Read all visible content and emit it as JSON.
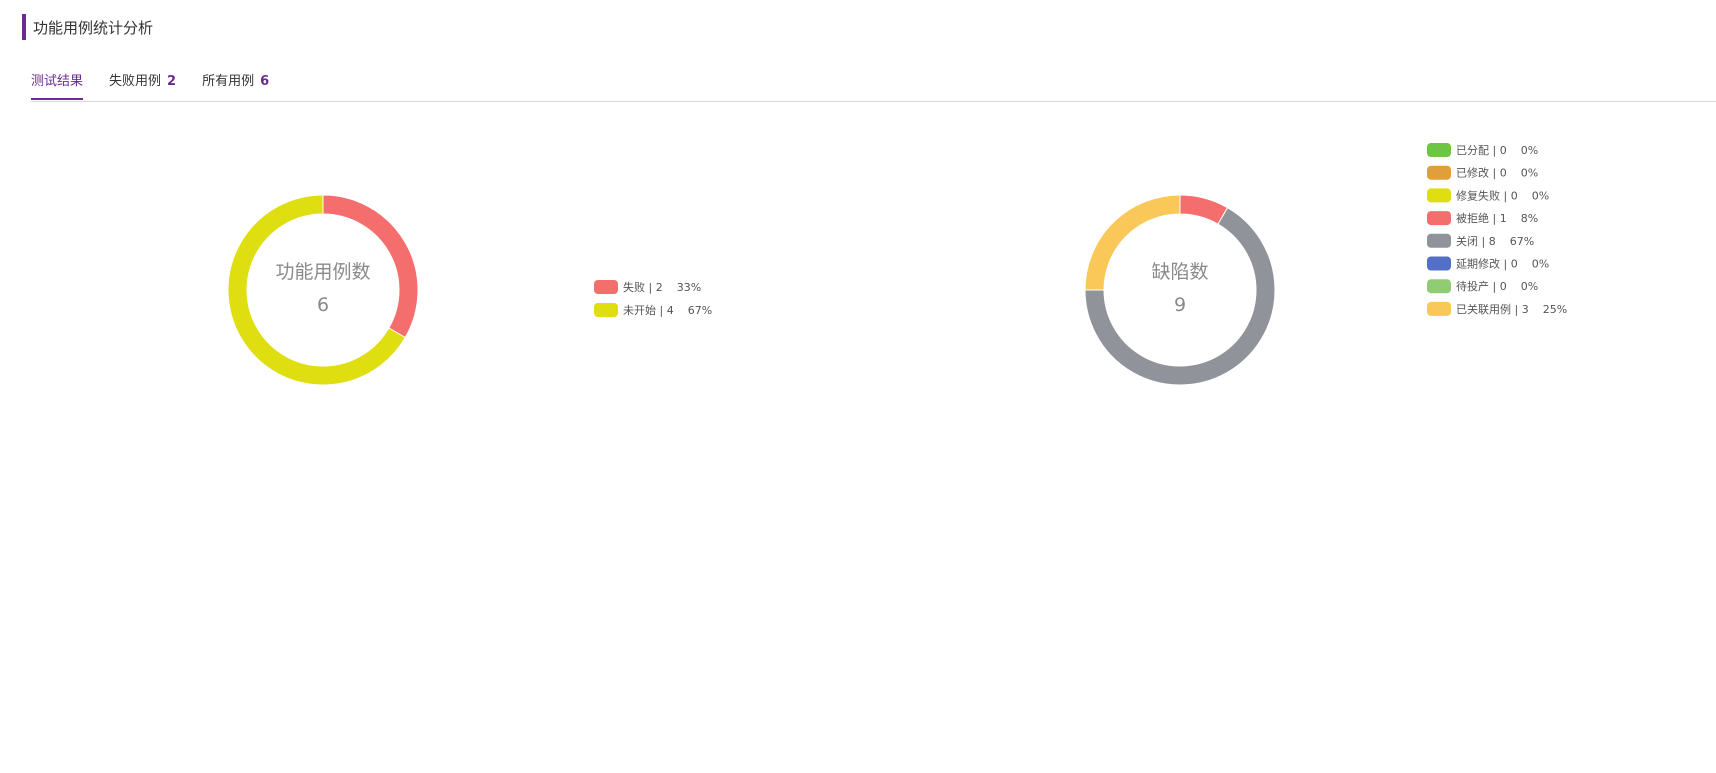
{
  "header": {
    "title": "功能用例统计分析"
  },
  "tabs": [
    {
      "label": "测试结果",
      "count": "",
      "active": true
    },
    {
      "label": "失败用例",
      "count": "2",
      "active": false
    },
    {
      "label": "所有用例",
      "count": "6",
      "active": false
    }
  ],
  "chart_data": [
    {
      "type": "pie",
      "center_title": "功能用例数",
      "center_value": "6",
      "slices": [
        {
          "name": "失败",
          "value": 2,
          "percent": "33%",
          "color": "#f46e6e"
        },
        {
          "name": "未开始",
          "value": 4,
          "percent": "67%",
          "color": "#dede10"
        }
      ]
    },
    {
      "type": "pie",
      "center_title": "缺陷数",
      "center_value": "9",
      "slices": [
        {
          "name": "已分配",
          "value": 0,
          "percent": "0%",
          "color": "#6cc644"
        },
        {
          "name": "已修改",
          "value": 0,
          "percent": "0%",
          "color": "#e39e3c"
        },
        {
          "name": "修复失败",
          "value": 0,
          "percent": "0%",
          "color": "#dede10"
        },
        {
          "name": "被拒绝",
          "value": 1,
          "percent": "8%",
          "color": "#f46e6e"
        },
        {
          "name": "关闭",
          "value": 8,
          "percent": "67%",
          "color": "#909399"
        },
        {
          "name": "延期修改",
          "value": 0,
          "percent": "0%",
          "color": "#5470c6"
        },
        {
          "name": "待投产",
          "value": 0,
          "percent": "0%",
          "color": "#91cc75"
        },
        {
          "name": "已关联用例",
          "value": 3,
          "percent": "25%",
          "color": "#fac858"
        }
      ]
    }
  ]
}
